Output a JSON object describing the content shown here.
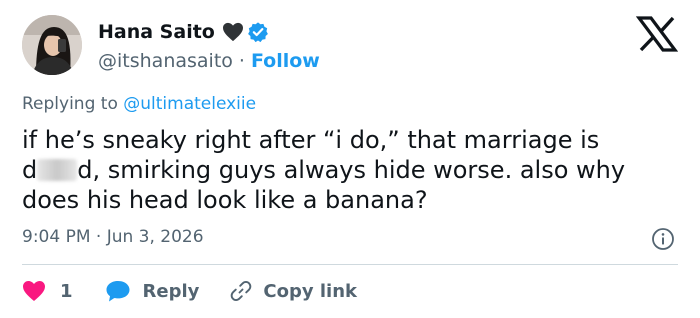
{
  "author": {
    "display_name": "Hana Saito",
    "handle": "@itshanasaito",
    "separator": "·",
    "follow_label": "Follow"
  },
  "reply": {
    "prefix": "Replying to ",
    "to_handle": "@ultimatelexiie"
  },
  "tweet": {
    "line1": "if he’s sneaky right after “i do,” that marriage is",
    "line2_start": "d",
    "line2_end": "d, smirking guys always hide worse. also why",
    "line3": "does his head look like a banana?"
  },
  "timestamp": "9:04 PM · Jun 3, 2026",
  "actions": {
    "like_count": "1",
    "reply_label": "Reply",
    "copy_label": "Copy link"
  },
  "colors": {
    "accent": "#1d9bf0",
    "like": "#f91880",
    "muted": "#536471",
    "text": "#0f1419"
  },
  "icons": [
    "heart-emoji-icon",
    "verified-badge-icon",
    "x-logo-icon",
    "info-icon",
    "heart-icon",
    "reply-bubble-icon",
    "link-icon"
  ]
}
